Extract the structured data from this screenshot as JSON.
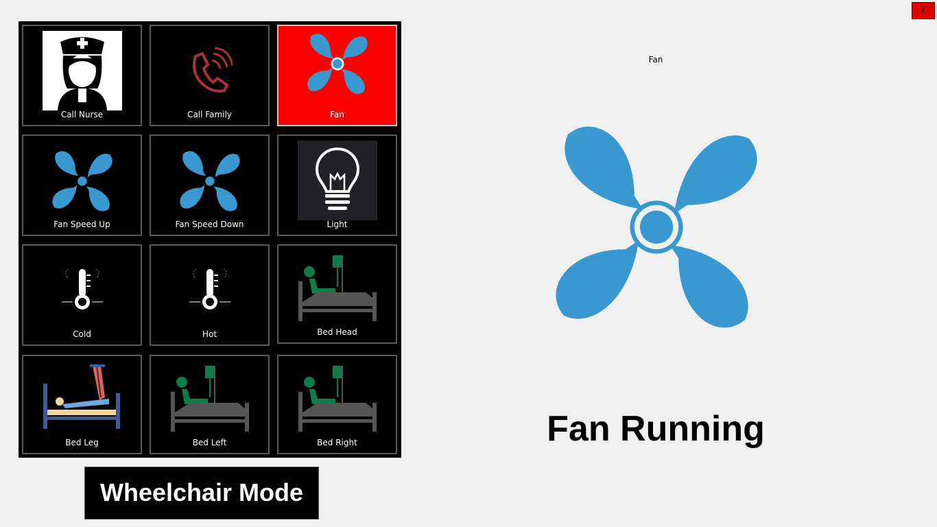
{
  "close_button": {
    "label": "X"
  },
  "tiles": [
    {
      "label": "Call Nurse",
      "icon": "nurse-icon",
      "active": false
    },
    {
      "label": "Call Family",
      "icon": "phone-icon",
      "active": false
    },
    {
      "label": "Fan",
      "icon": "fan-icon",
      "active": true
    },
    {
      "label": "Fan Speed Up",
      "icon": "fan-icon",
      "active": false
    },
    {
      "label": "Fan Speed Down",
      "icon": "fan-icon",
      "active": false
    },
    {
      "label": "Light",
      "icon": "lightbulb-icon",
      "active": false
    },
    {
      "label": "Cold",
      "icon": "thermometer-icon",
      "active": false
    },
    {
      "label": "Hot",
      "icon": "thermometer-icon",
      "active": false
    },
    {
      "label": "Bed Head",
      "icon": "patient-bed-icon",
      "active": false
    },
    {
      "label": "Bed Leg",
      "icon": "bed-leg-icon",
      "active": false
    },
    {
      "label": "Bed Left",
      "icon": "patient-bed-icon",
      "active": false
    },
    {
      "label": "Bed Right",
      "icon": "patient-bed-icon",
      "active": false
    }
  ],
  "status": {
    "caption": "Fan",
    "icon": "fan-icon",
    "text": "Fan Running"
  },
  "mode_button": {
    "label": "Wheelchair Mode"
  },
  "colors": {
    "active_tile": "#ff0000",
    "fan_blue": "#3a98d1",
    "panel_bg": "#000000",
    "page_bg": "#f0f0f0"
  }
}
